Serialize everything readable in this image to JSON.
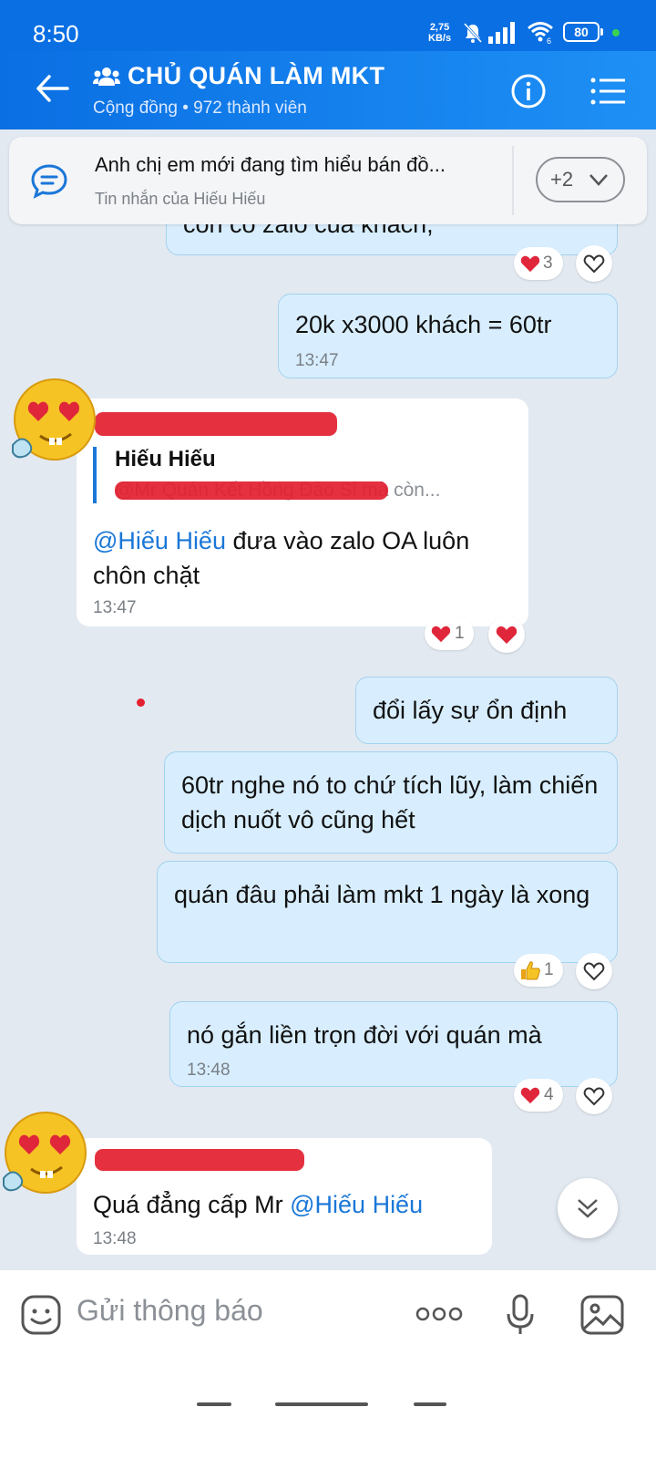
{
  "status_bar": {
    "time": "8:50",
    "net_speed": "2,75",
    "net_unit": "KB/s",
    "wifi_label": "6",
    "battery": "80"
  },
  "header": {
    "title": "CHỦ QUÁN LÀM MKT",
    "subtitle": "Cộng đồng • 972 thành viên"
  },
  "pinned": {
    "text": "Anh chị em mới đang tìm hiểu bán đồ...",
    "sub": "Tin nhắn của Hiếu Hiếu",
    "more": "+2"
  },
  "messages": [
    {
      "id": "m0",
      "text": "con có zalo của khách,",
      "reaction_count": "3"
    },
    {
      "id": "m1",
      "text": "20k x3000 khách = 60tr",
      "time": "13:47"
    },
    {
      "id": "m2",
      "quote_name": "Hiếu Hiếu",
      "quote_text": "@Mr Quán Kết Hồng Đào Sỉ mà còn...",
      "mention": "@Hiếu Hiếu",
      "text": " đưa vào zalo OA luôn chôn chặt",
      "time": "13:47",
      "reaction_count": "1"
    },
    {
      "id": "m3",
      "text": "đổi lấy sự ổn định"
    },
    {
      "id": "m4",
      "text": "60tr nghe nó to chứ tích lũy, làm chiến dịch nuốt vô cũng hết"
    },
    {
      "id": "m5",
      "text": "quán đâu phải làm mkt 1 ngày là xong",
      "reaction_count": "1"
    },
    {
      "id": "m6",
      "text": "nó gắn liền trọn đời với quán mà",
      "time": "13:48",
      "reaction_count": "4"
    },
    {
      "id": "m7",
      "text": "Quá đẳng cấp Mr ",
      "mention": "@Hiếu Hiếu",
      "time": "13:48"
    }
  ],
  "input": {
    "placeholder": "Gửi thông báo"
  },
  "colors": {
    "brand": "#0a6fe3",
    "outgoing_bubble": "#d8eefe",
    "mention": "#1a77d8",
    "heart": "#e0263a"
  }
}
